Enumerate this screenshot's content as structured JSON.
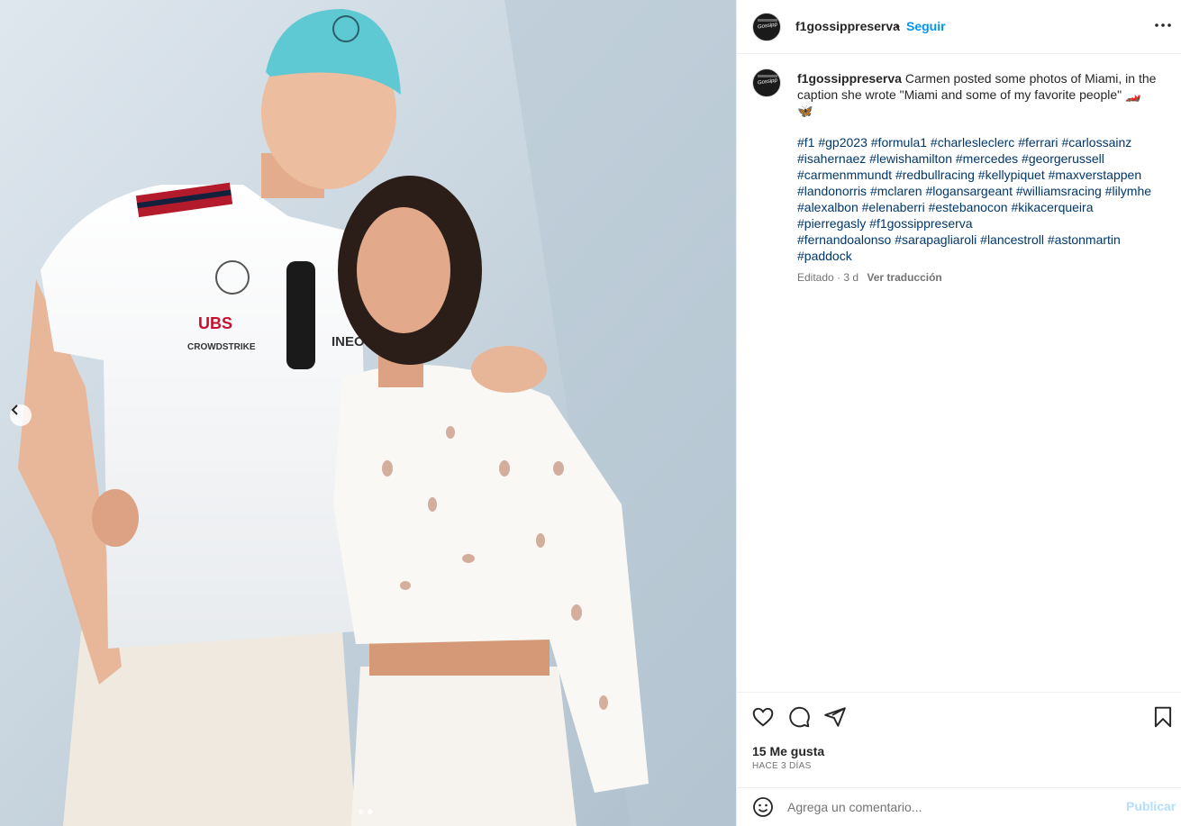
{
  "post": {
    "username": "f1gossippreserva",
    "follow_label": "Seguir",
    "separator": "•",
    "more_icon": "more-horizontal-icon",
    "avatar_text": "Gossipp"
  },
  "caption": {
    "username": "f1gossippreserva",
    "text": "Carmen posted some photos of Miami, in the caption she wrote \"Miami and some of my favorite people\" 🏎️ 🦋",
    "hashtags": [
      "#f1",
      "#gp2023",
      "#formula1",
      "#charlesleclerc",
      "#ferrari",
      "#carlossainz",
      "#isahernaez",
      "#lewishamilton",
      "#mercedes",
      "#georgerussell",
      "#carmenmmundt",
      "#redbullracing",
      "#kellypiquet",
      "#maxverstappen",
      "#landonorris",
      "#mclaren",
      "#logansargeant",
      "#williamsracing",
      "#lilymhe",
      "#alexalbon",
      "#elenaberri",
      "#estebanocon",
      "#kikacerqueira",
      "#pierregasly",
      "#f1gossippreserva",
      "#fernandoalonso",
      "#sarapagliaroli",
      "#lancestroll",
      "#astonmartin",
      "#paddock"
    ],
    "edited_label": "Editado · 3 d",
    "translate_label": "Ver traducción"
  },
  "actions": {
    "likes_label": "15 Me gusta",
    "time_label": "HACE 3 DÍAS",
    "icons": [
      "heart-icon",
      "comment-icon",
      "share-icon",
      "bookmark-icon"
    ]
  },
  "comment": {
    "placeholder": "Agrega un comentario...",
    "publish_label": "Publicar"
  },
  "carousel": {
    "slide_count": 2,
    "active_index": 0
  },
  "colors": {
    "link": "#0095f6",
    "hashtag": "#00376b",
    "muted": "#737373",
    "publish_disabled": "#b2dffc"
  }
}
